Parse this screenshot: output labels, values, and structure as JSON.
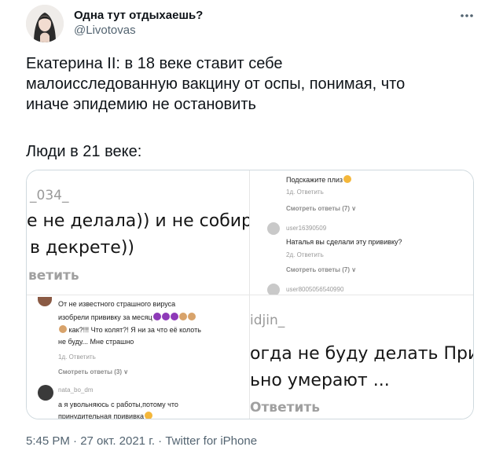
{
  "author": {
    "display_name": "Одна тут отдыхаешь?",
    "username": "@Livotovas",
    "avatar": "avatar-image",
    "more_icon": "more-horizontal-icon"
  },
  "tweet": {
    "text": "Екатерина II: в 18 веке ставит себе\nмалоисследованную вакцину от оспы, понимая, что\nиначе эпидемию не остановить",
    "text2": "Люди в 21 веке:"
  },
  "media": {
    "top_left": {
      "line1": "_034_",
      "line2": "е не делала)) и не собирак",
      "line3": "в декрете))",
      "line4": "ветить"
    },
    "top_right": {
      "c1_text": "Подскажите плиз",
      "c1_meta": "1д.   Ответить",
      "c1_replies": "Смотреть ответы (7) ∨",
      "c2_user": "user16390509",
      "c2_text": "Наталья вы сделали эту прививку?",
      "c2_meta": "2д.   Ответить",
      "c2_replies": "Смотреть ответы (7) ∨",
      "c3_user": "user8005056540990"
    },
    "bottom_left": {
      "c1_line1": "От не известного страшного вируса",
      "c1_line2": "изобрели прививку за месяц",
      "c1_line3": "как?!!! Что колят?! Я ни за что её колоть",
      "c1_line4": "не буду... Мне страшно",
      "c1_meta": "1д.   Ответить",
      "c1_replies": "Смотреть ответы (3) ∨",
      "c2_user": "nata_bo_dm",
      "c2_line1": "а я увольняюсь с работы,потому что",
      "c2_line2": "принудительная прививка"
    },
    "bottom_right": {
      "line1": "idjin_",
      "line2": "огда не буду делать Привив",
      "line3": "ьно умерают ...",
      "line4": "Ответить"
    }
  },
  "footer": {
    "meta": "5:45 PM · 27 окт. 2021 г. · Twitter for iPhone"
  },
  "colors": {
    "text": "#0f1419",
    "secondary": "#536471",
    "border": "#cfd9de"
  }
}
